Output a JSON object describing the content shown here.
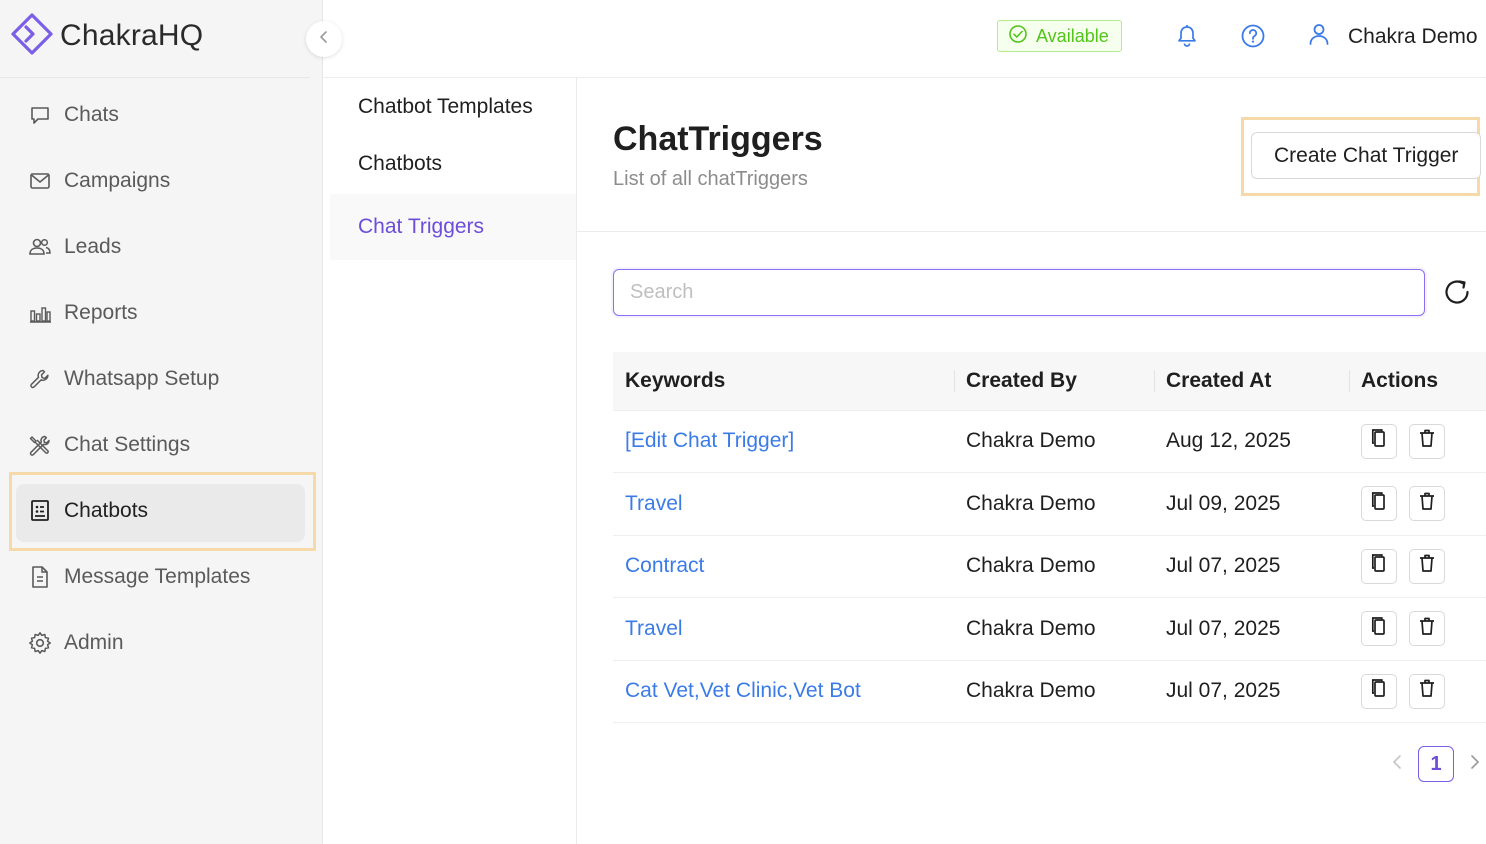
{
  "brand": {
    "name": "ChakraHQ"
  },
  "sidebar": {
    "items": [
      {
        "label": "Chats",
        "icon": "chat-icon"
      },
      {
        "label": "Campaigns",
        "icon": "envelope-icon"
      },
      {
        "label": "Leads",
        "icon": "users-icon"
      },
      {
        "label": "Reports",
        "icon": "bar-chart-icon"
      },
      {
        "label": "Whatsapp Setup",
        "icon": "wrench-icon"
      },
      {
        "label": "Chat Settings",
        "icon": "tools-icon"
      },
      {
        "label": "Chatbots",
        "icon": "chatbot-icon",
        "active": true
      },
      {
        "label": "Message Templates",
        "icon": "document-icon"
      },
      {
        "label": "Admin",
        "icon": "gear-icon"
      }
    ]
  },
  "header": {
    "status": "Available",
    "user_name": "Chakra Demo"
  },
  "subnav": {
    "items": [
      {
        "label": "Chatbot Templates"
      },
      {
        "label": "Chatbots"
      },
      {
        "label": "Chat Triggers",
        "active": true
      }
    ]
  },
  "main": {
    "title": "ChatTriggers",
    "subtitle": "List of all chatTriggers",
    "create_label": "Create Chat Trigger",
    "search_placeholder": "Search",
    "table": {
      "headers": [
        "Keywords",
        "Created By",
        "Created At",
        "Actions"
      ],
      "rows": [
        {
          "keywords": "[Edit Chat Trigger]",
          "created_by": "Chakra Demo",
          "created_at": "Aug 12, 2025"
        },
        {
          "keywords": "Travel",
          "created_by": "Chakra Demo",
          "created_at": "Jul 09, 2025"
        },
        {
          "keywords": "Contract",
          "created_by": "Chakra Demo",
          "created_at": "Jul 07, 2025"
        },
        {
          "keywords": "Travel",
          "created_by": "Chakra Demo",
          "created_at": "Jul 07, 2025"
        },
        {
          "keywords": "Cat Vet,Vet Clinic,Vet Bot",
          "created_by": "Chakra Demo",
          "created_at": "Jul 07, 2025"
        }
      ]
    },
    "pagination": {
      "current_page": "1"
    }
  },
  "colors": {
    "accent": "#6c4ed9",
    "link": "#3b7be8",
    "status_green": "#52c41a",
    "highlight": "#f6d9a8"
  }
}
